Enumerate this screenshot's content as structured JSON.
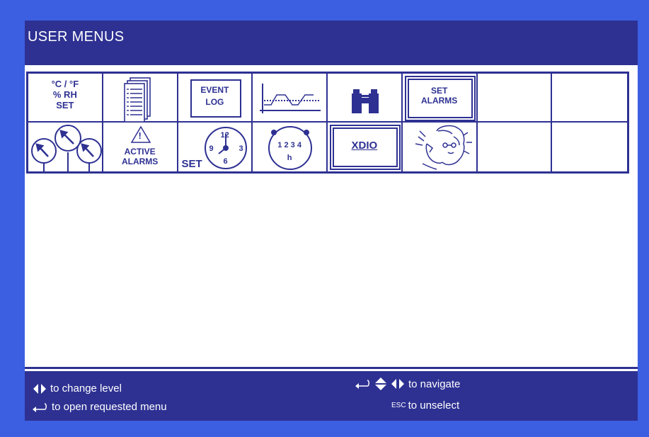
{
  "header": {
    "title": "USER MENUS"
  },
  "menu": {
    "temp_rh_set": {
      "line1": "°C / °F",
      "line2": "% RH",
      "line3": "SET"
    },
    "event_log": {
      "line1": "EVENT",
      "line2": "LOG"
    },
    "set_alarms": {
      "line1": "SET",
      "line2": "ALARMS"
    },
    "active_alarms": {
      "symbol": "!",
      "line1": "ACTIVE",
      "line2": "ALARMS"
    },
    "set_clock": {
      "label": "SET",
      "n12": "12",
      "n3": "3",
      "n6": "6",
      "n9": "9"
    },
    "timer": {
      "digits": "1 2 3 4",
      "unit": "h"
    },
    "xdio": {
      "label": "XDIO"
    }
  },
  "footer": {
    "change_level": "to change level",
    "open_menu": "to open requested menu",
    "navigate": "to navigate",
    "esc_key": "ESC",
    "unselect": "to unselect"
  },
  "colors": {
    "navy": "#2e3192",
    "frame": "#3b5fe0",
    "screen": "#ffffff"
  },
  "icons": [
    "document-list-icon",
    "trend-graph-icon",
    "binoculars-icon",
    "gauges-icon",
    "warning-triangle-icon",
    "clock-icon",
    "timer-dial-icon",
    "service-person-phone-icon",
    "arrow-left-right-icon",
    "enter-key-icon",
    "arrow-up-down-icon"
  ]
}
